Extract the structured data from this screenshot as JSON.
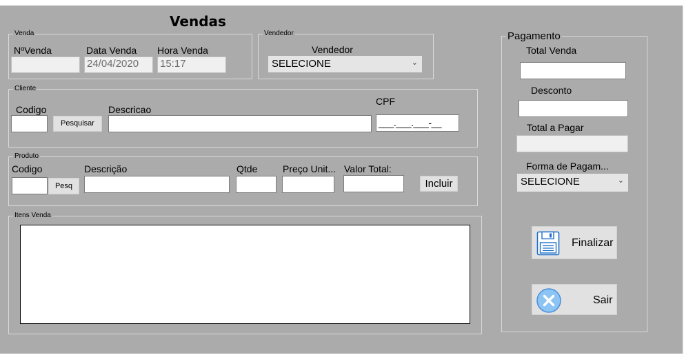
{
  "form_title": "Vendas",
  "venda": {
    "legend": "Venda",
    "numero_label": "NºVenda",
    "numero_value": "",
    "data_label": "Data Venda",
    "data_value": "24/04/2020",
    "hora_label": "Hora Venda",
    "hora_value": "15:17"
  },
  "vendedor": {
    "legend": "Vendedor",
    "label": "Vendedor",
    "selected": "SELECIONE"
  },
  "cliente": {
    "legend": "Cliente",
    "codigo_label": "Codigo",
    "pesquisar_label": "Pesquisar",
    "descricao_label": "Descricao",
    "cpf_label": "CPF",
    "cpf_mask": "___.___.___-__"
  },
  "produto": {
    "legend": "Produto",
    "codigo_label": "Codigo",
    "pesq_label": "Pesq",
    "descricao_label": "Descrição",
    "qtde_label": "Qtde",
    "preco_label": "Preço Unit...",
    "valor_total_label": "Valor Total:",
    "incluir_label": "Incluir"
  },
  "itens": {
    "legend": "Itens Venda"
  },
  "pagamento": {
    "legend": "Pagamento",
    "total_venda_label": "Total Venda",
    "desconto_label": "Desconto",
    "total_pagar_label": "Total a Pagar",
    "forma_label": "Forma de Pagam...",
    "forma_selected": "SELECIONE",
    "finalizar_label": "Finalizar",
    "sair_label": "Sair"
  },
  "icons": {
    "floppy": "floppy-disk-icon",
    "close": "close-circle-icon",
    "chevron": "chevron-down-icon"
  },
  "colors": {
    "form_bg": "#ababab",
    "close_icon_fill": "#8cc4f4",
    "floppy_icon": "#1e6fc9"
  }
}
